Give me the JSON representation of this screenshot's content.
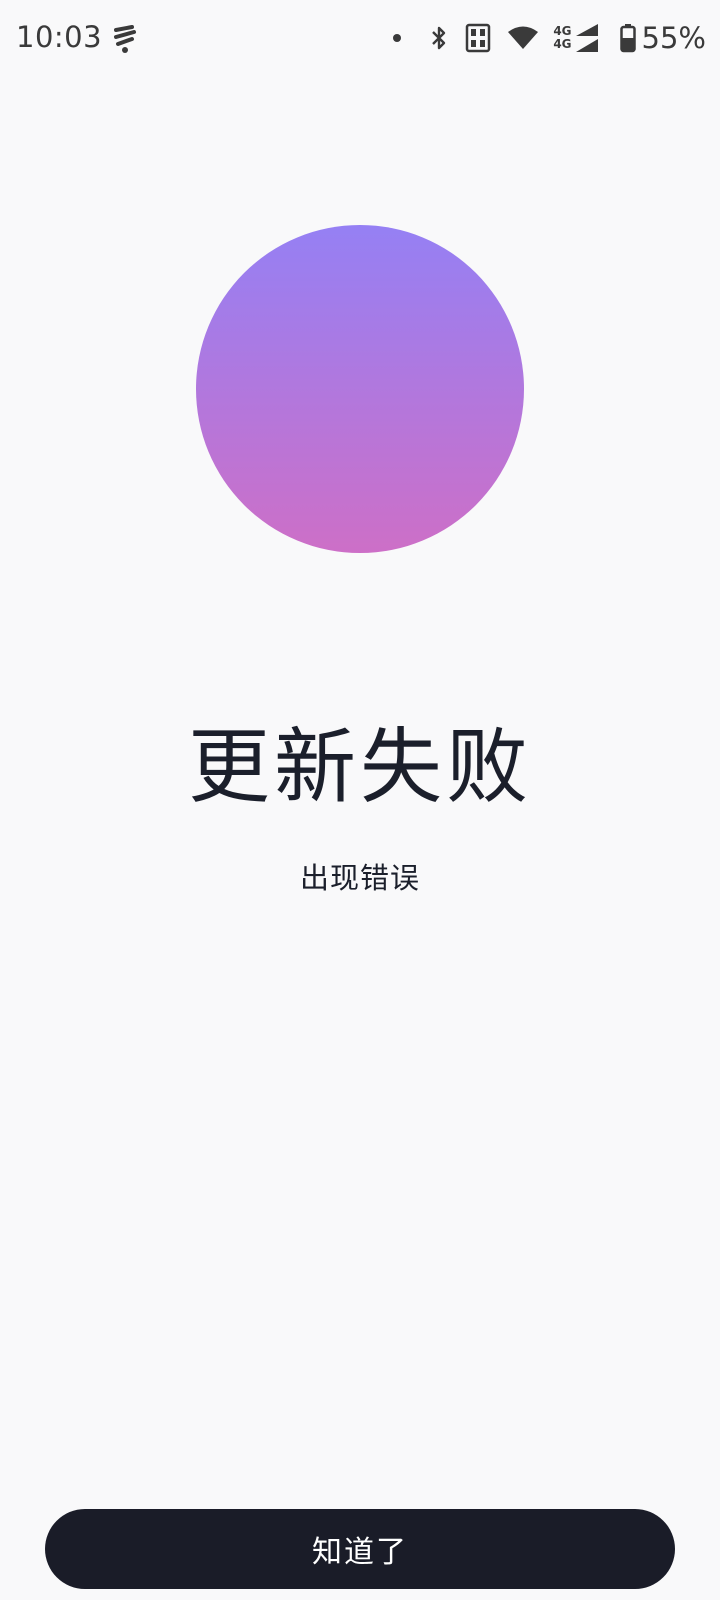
{
  "status_bar": {
    "time": "10:03",
    "network_top": "4G",
    "network_bottom": "4G",
    "battery": "55%",
    "icons": [
      "notification-app-icon",
      "dot-icon",
      "bluetooth-icon",
      "nfc-icon",
      "wifi-icon",
      "signal-icon",
      "battery-icon"
    ]
  },
  "main": {
    "title": "更新失败",
    "subtitle": "出现错误",
    "gradient_top": "#9580f4",
    "gradient_bottom": "#cd6fc7"
  },
  "actions": {
    "ok_label": "知道了"
  }
}
